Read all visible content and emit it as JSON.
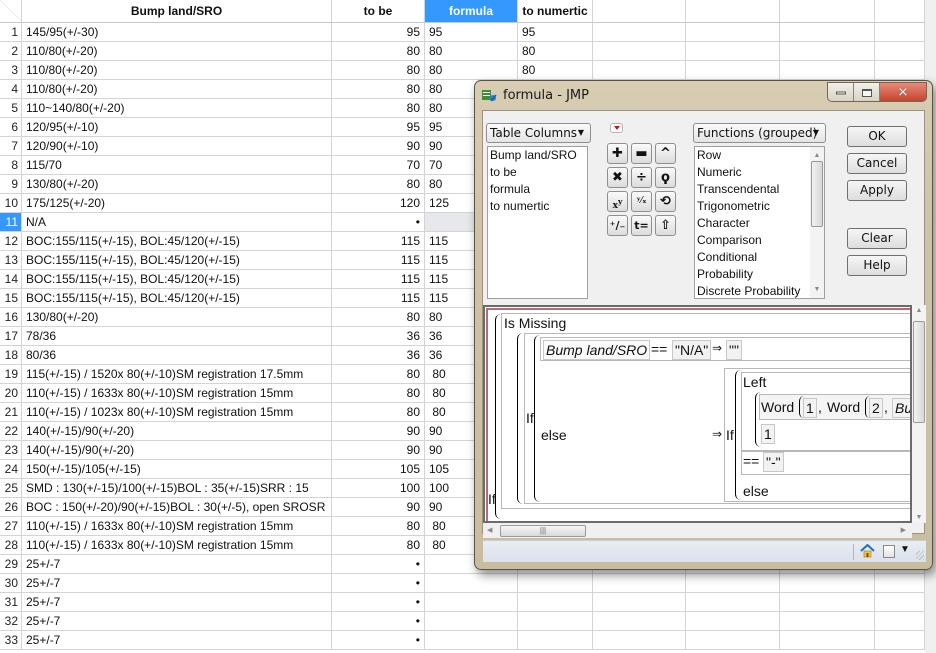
{
  "spreadsheet": {
    "columns": [
      "Bump land/SRO",
      "to be",
      "formula",
      "to numertic"
    ],
    "selected_column": "formula",
    "selected_row": 11,
    "missing_marker": "•",
    "rows": [
      {
        "n": "1",
        "bump": "145/95(+/-30)",
        "tobe": "95",
        "formula": "95",
        "num": "95"
      },
      {
        "n": "2",
        "bump": "110/80(+/-20)",
        "tobe": "80",
        "formula": "80",
        "num": "80"
      },
      {
        "n": "3",
        "bump": "110/80(+/-20)",
        "tobe": "80",
        "formula": "80",
        "num": "80"
      },
      {
        "n": "4",
        "bump": "110/80(+/-20)",
        "tobe": "80",
        "formula": "80",
        "num": ""
      },
      {
        "n": "5",
        "bump": "110~140/80(+/-20)",
        "tobe": "80",
        "formula": "80",
        "num": ""
      },
      {
        "n": "6",
        "bump": "120/95(+/-10)",
        "tobe": "95",
        "formula": "95",
        "num": ""
      },
      {
        "n": "7",
        "bump": "120/90(+/-10)",
        "tobe": "90",
        "formula": "90",
        "num": ""
      },
      {
        "n": "8",
        "bump": "115/70",
        "tobe": "70",
        "formula": "70",
        "num": ""
      },
      {
        "n": "9",
        "bump": "130/80(+/-20)",
        "tobe": "80",
        "formula": "80",
        "num": ""
      },
      {
        "n": "10",
        "bump": "175/125(+/-20)",
        "tobe": "120",
        "formula": "125",
        "num": ""
      },
      {
        "n": "11",
        "bump": "N/A",
        "tobe": "•",
        "formula": "",
        "num": ""
      },
      {
        "n": "12",
        "bump": "BOC:155/115(+/-15), BOL:45/120(+/-15)",
        "tobe": "115",
        "formula": "115",
        "num": ""
      },
      {
        "n": "13",
        "bump": "BOC:155/115(+/-15), BOL:45/120(+/-15)",
        "tobe": "115",
        "formula": "115",
        "num": ""
      },
      {
        "n": "14",
        "bump": "BOC:155/115(+/-15), BOL:45/120(+/-15)",
        "tobe": "115",
        "formula": "115",
        "num": ""
      },
      {
        "n": "15",
        "bump": "BOC:155/115(+/-15), BOL:45/120(+/-15)",
        "tobe": "115",
        "formula": "115",
        "num": ""
      },
      {
        "n": "16",
        "bump": "130/80(+/-20)",
        "tobe": "80",
        "formula": "80",
        "num": ""
      },
      {
        "n": "17",
        "bump": "78/36",
        "tobe": "36",
        "formula": "36",
        "num": ""
      },
      {
        "n": "18",
        "bump": "80/36",
        "tobe": "36",
        "formula": "36",
        "num": ""
      },
      {
        "n": "19",
        "bump": "115(+/-15) / 1520x 80(+/-10)SM registration 17.5mm",
        "tobe": "80",
        "formula": " 80",
        "num": ""
      },
      {
        "n": "20",
        "bump": "110(+/-15) / 1633x 80(+/-10)SM registration 15mm",
        "tobe": "80",
        "formula": " 80",
        "num": ""
      },
      {
        "n": "21",
        "bump": "110(+/-15) / 1023x 80(+/-10)SM registration 15mm",
        "tobe": "80",
        "formula": " 80",
        "num": ""
      },
      {
        "n": "22",
        "bump": "140(+/-15)/90(+/-20)",
        "tobe": "90",
        "formula": "90",
        "num": ""
      },
      {
        "n": "23",
        "bump": "140(+/-15)/90(+/-20)",
        "tobe": "90",
        "formula": "90",
        "num": ""
      },
      {
        "n": "24",
        "bump": "150(+/-15)/105(+/-15)",
        "tobe": "105",
        "formula": "105",
        "num": ""
      },
      {
        "n": "25",
        "bump": "SMD : 130(+/-15)/100(+/-15)BOL : 35(+/-15)SRR : 15",
        "tobe": "100",
        "formula": "100",
        "num": ""
      },
      {
        "n": "26",
        "bump": "BOC : 150(+/-20)/90(+/-15)BOL : 30(+/-5), open SROSR",
        "tobe": "90",
        "formula": "90",
        "num": ""
      },
      {
        "n": "27",
        "bump": "110(+/-15) / 1633x 80(+/-10)SM registration 15mm",
        "tobe": "80",
        "formula": " 80",
        "num": ""
      },
      {
        "n": "28",
        "bump": "110(+/-15) / 1633x 80(+/-10)SM registration 15mm",
        "tobe": "80",
        "formula": " 80",
        "num": ""
      },
      {
        "n": "29",
        "bump": "25+/-7",
        "tobe": "•",
        "formula": "",
        "num": ""
      },
      {
        "n": "30",
        "bump": "25+/-7",
        "tobe": "•",
        "formula": "",
        "num": ""
      },
      {
        "n": "31",
        "bump": "25+/-7",
        "tobe": "•",
        "formula": "",
        "num": ""
      },
      {
        "n": "32",
        "bump": "25+/-7",
        "tobe": "•",
        "formula": "",
        "num": ""
      },
      {
        "n": "33",
        "bump": "25+/-7",
        "tobe": "•",
        "formula": "",
        "num": ""
      }
    ]
  },
  "dialog": {
    "title": "formula - JMP",
    "table_columns_dropdown": "Table Columns",
    "table_columns": [
      "Bump land/SRO",
      "to be",
      "formula",
      "to numertic"
    ],
    "functions_dropdown": "Functions (grouped)",
    "functions": [
      "Row",
      "Numeric",
      "Transcendental",
      "Trigonometric",
      "Character",
      "Comparison",
      "Conditional",
      "Probability",
      "Discrete Probability"
    ],
    "operators": [
      "+",
      "−",
      "^",
      "×",
      "÷",
      "root",
      "xʸ",
      "y/x",
      "swap",
      "+/−",
      "t=",
      "peel"
    ],
    "buttons": {
      "ok": "OK",
      "cancel": "Cancel",
      "apply": "Apply",
      "clear": "Clear",
      "help": "Help"
    },
    "formula": {
      "outer_if": "If",
      "is_missing": "Is Missing",
      "inner_if": "If",
      "column_ref": "Bump land/SRO",
      "eq_op": "==",
      "na_literal": "\"N/A\"",
      "arrow": "⇒",
      "empty_literal": "\"\"",
      "else": "else",
      "nested_if": "If",
      "left_fn": "Left",
      "word_fn": "Word",
      "word_arg1": "1",
      "comma": ",",
      "word_arg2": "2",
      "col_truncated": "Bum",
      "left_arg": "1",
      "dash_literal": "\"-\"",
      "else2": "else"
    }
  }
}
